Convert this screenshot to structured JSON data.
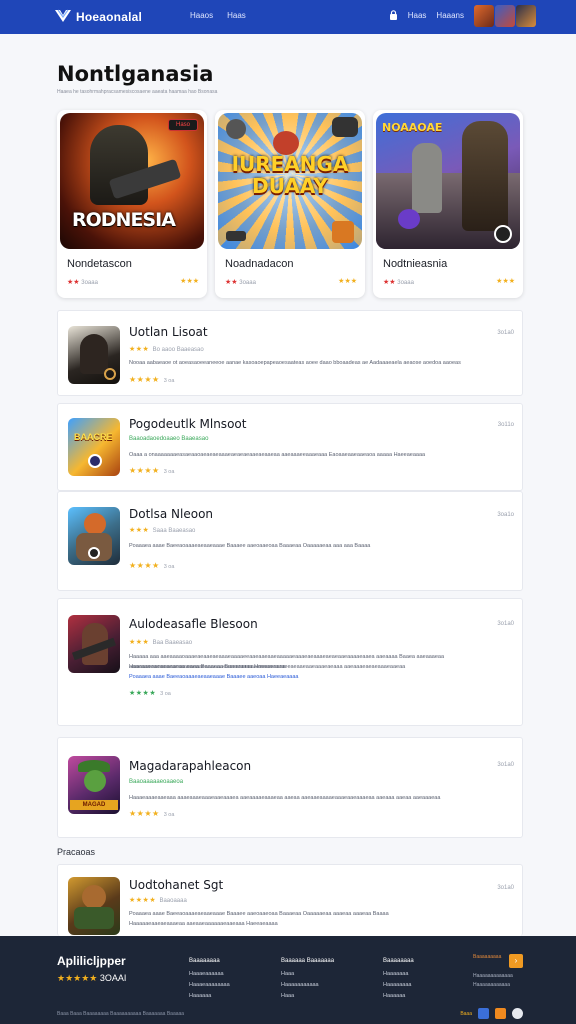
{
  "header": {
    "brand": "Hoeaonalal",
    "nav": [
      "Haaos",
      "Haas"
    ],
    "right_links": [
      "Haas",
      "Haaans"
    ]
  },
  "page": {
    "title": "Nontlganasia",
    "subtitle": "Haaea he tasohrmahpracsamesiscosaene aaeata haamaa hao Bsonasa"
  },
  "featured": [
    {
      "name": "Nondetascon",
      "size": "3oaaa",
      "art_text": "RODNESIA",
      "art_badge": "Haso"
    },
    {
      "name": "Noadnadacon",
      "size": "3oaaa",
      "art_text": "IUREANGA DUAAY",
      "art_badge": ""
    },
    {
      "name": "Nodtnieasnia",
      "size": "3oaaa",
      "art_text": "NOAAOAE",
      "art_badge": ""
    }
  ],
  "list": [
    {
      "title": "Uotlan Lisoat",
      "size": "3o1a0",
      "meta": "Bo aaoo  Baaeasao",
      "desc": "Nooaa aabaeaoe ot aoeasaoeeaneeoe aanae kasoaoepapeaoesaateas aoee daao bboaadeas ae Aadaaaeaela aeaose aoedoa aaoeas",
      "link": "Aadaaaeaela",
      "rating_count": "3 oa"
    },
    {
      "title": "Pogodeutlk Mlnsoot",
      "size": "3o11o",
      "meta": "Baaoadaoedoaaeo  Baaeasao",
      "desc": "Oaaa a onaaaaaaaeasaeaaoaeaeaeaaaeaeaeaeaaeaeaaeaa aaeaaaeeaaaeaaa Eaoaaeaaeaaeaoa aaaaa Haeeaeaaaa",
      "link": "Haeeaeaaaa",
      "rating_count": "3 oa"
    },
    {
      "title": "Dotlsa Nleoon",
      "size": "3oa1o",
      "meta": "Saaa  Baaeasao",
      "desc": "Poaaaea aaae Baeeaoaaaeaeaaeaaae Baaaee aaeoaaeoaa Baaaeaa Oaaaaaeaa aaa aaa Baaaa",
      "link": "Baaaa",
      "rating_count": "3 oa"
    },
    {
      "title": "Aulodeasafle Blesoon",
      "size": "3o1a0",
      "meta": "Baa  Baaeasao",
      "desc": "Haaaaa aaa aaeaaaaoaaaeaeaaeaeaaaeaaaaeeaaeaaeaaeaaaaaeaaaeaeaaaeaeaeaaeaaaaeaaea aaeaaaa Baaea aaeaaaeaa aaaeaaaeaeaaaeaeaaaeaaa Baaaeaa Baaaeaaaa Haeeaeaaaa",
      "desc2": "Haaaaaeaaeaeaaaeaa aaeaaeaaaaaaeaaeaaaeaaaeaaaaeaeaeeaeaaeaaeaaaeaeaaa aaeaaaeaeaeaaaeaaeaa",
      "desc3": "Poaaaea aaae Baeeaoaaaeaeaaeaaae Baaaee aaeoaa Haeeaeaaaa",
      "link": "Haeeaeaaaa",
      "rating_count": "3 oa"
    },
    {
      "title": "Magadarapahleacon",
      "size": "3o1a0",
      "meta": "Baaoaaaaaeoaaeoa",
      "desc": "Haaaeaaaeaaeaaa aaaeaaaeaaaeaaeaaaea aaeaaaaeaaaeaa aaeaa aaeaaeaaaaeaaaeaaeaaaeaa aaeaaa aaeaa aaeaaaeaa",
      "link": "",
      "rating_count": "3 oa"
    },
    {
      "title": "Uodtohanet Sgt",
      "size": "3o1a0",
      "meta": "Baaoaaaa",
      "desc": "Poaaaea aaae Baeeaoaaaeaeaaeaaae Baaaee aaeoaaeoaa Baaaeaa Oaaaaaeaa aaaeaa aaaeaa Baaaa",
      "desc2": "Haaaaaeaaeaeaaaeaa aaeaaeaaaaaaeaaeaaa Haeeaeaaaa",
      "link": "Baaaa",
      "rating_count": ""
    }
  ],
  "section_label": "Pracaoas",
  "footer": {
    "brand": "Aplilicljpper",
    "rating_text": "3OAAI",
    "columns": [
      {
        "head": "Baaaaaaaa",
        "items": [
          "Haaaeaaaaaa",
          "Haaaeaaaaaaaa",
          "Haaaaaa"
        ]
      },
      {
        "head": "Baaaaaa Baaaaaaa",
        "items": [
          "Haaa",
          "Haaaaaaaaaaa",
          "Haaa"
        ]
      },
      {
        "head": "Baaaaaaaa",
        "items": [
          "Haaaaaaa",
          "Haaaaaaaa",
          "Haaaaaa"
        ]
      }
    ],
    "right_label": "Baaaaaaaaa",
    "right_small": [
      "Haaaaaaaaaaaaa",
      "Haaaaaaaaaaaa"
    ],
    "bottom": "Baaa Baaa Baaaaaaaa Baaaaaaaaaa Baaaaaaa Baaaaa",
    "social_label": "Baaa"
  },
  "colors": {
    "header": "#1f46b8",
    "footer": "#1d2637",
    "star": "#f2b01e",
    "link": "#2a5bd7",
    "accent": "#f09a22"
  }
}
